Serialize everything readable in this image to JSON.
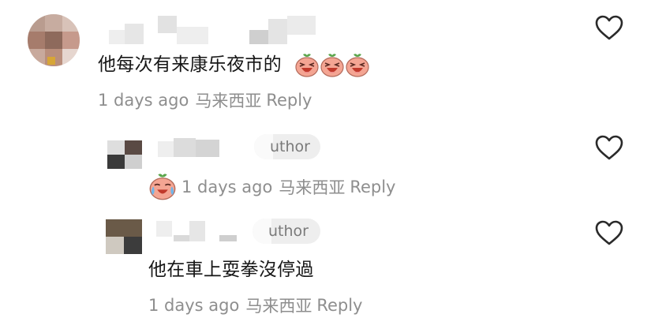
{
  "comments": [
    {
      "text": "他每次有来康乐夜市的",
      "emoji": [
        "laughing-peach-emoji",
        "laughing-peach-emoji",
        "laughing-peach-emoji"
      ],
      "time": "1 days ago",
      "location": "马来西亚",
      "reply_label": "Reply"
    },
    {
      "badge": "uthor",
      "emoji": [
        "crying-laughing-peach-emoji"
      ],
      "time": "1 days ago",
      "location": "马来西亚",
      "reply_label": "Reply"
    },
    {
      "badge": "uthor",
      "text": "他在車上耍拳沒停過",
      "time": "1 days ago",
      "location": "马来西亚",
      "reply_label": "Reply"
    }
  ],
  "colors": {
    "meta_text": "#8e8e8e",
    "body_text": "#161616",
    "heart_stroke": "#2a2a2a",
    "badge_bg": "#eeeeee"
  },
  "icons": [
    "heart-outline-icon",
    "laughing-peach-emoji",
    "crying-laughing-peach-emoji"
  ]
}
